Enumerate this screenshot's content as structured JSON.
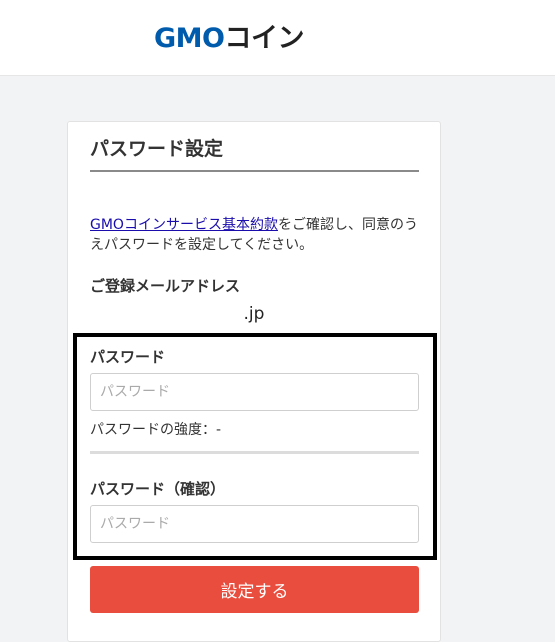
{
  "header": {
    "logo_gmo": "GMO",
    "logo_coin": "コイン"
  },
  "form": {
    "title": "パスワード設定",
    "intro_link": "GMOコインサービス基本約款",
    "intro_text": "をご確認し、同意のうえパスワードを設定してください。",
    "email_label": "ご登録メールアドレス",
    "email_value": ".jp",
    "password_label": "パスワード",
    "password_placeholder": "パスワード",
    "strength_text": "パスワードの強度：-",
    "confirm_label": "パスワード（確認）",
    "confirm_placeholder": "パスワード",
    "submit_label": "設定する"
  },
  "colors": {
    "brand_blue": "#005bac",
    "submit_red": "#e84d3d",
    "link": "#1a0dab"
  }
}
